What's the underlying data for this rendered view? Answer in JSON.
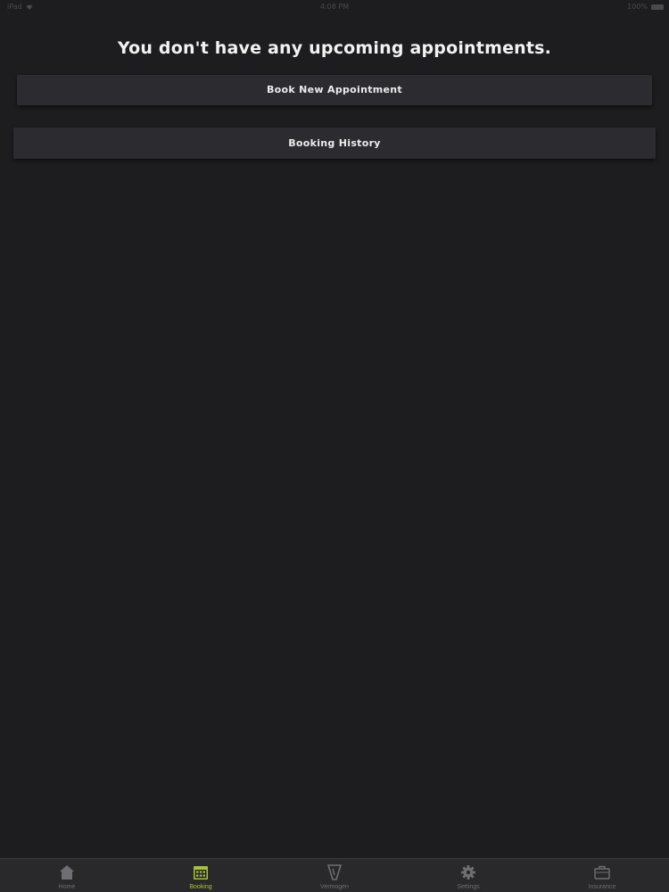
{
  "status_bar": {
    "carrier": "iPad",
    "time": "4:08 PM",
    "battery": "100%"
  },
  "main": {
    "empty_message": "You don't have any upcoming appointments.",
    "book_button_label": "Book New Appointment",
    "history_button_label": "Booking History"
  },
  "tab_bar": {
    "items": [
      {
        "label": "Home",
        "icon": "home-icon",
        "active": false
      },
      {
        "label": "Booking",
        "icon": "calendar-icon",
        "active": true
      },
      {
        "label": "Vermogen",
        "icon": "v-logo-icon",
        "active": false
      },
      {
        "label": "Settings",
        "icon": "gear-icon",
        "active": false
      },
      {
        "label": "Insurance",
        "icon": "briefcase-icon",
        "active": false
      }
    ]
  },
  "colors": {
    "background": "#1d1c1f",
    "button": "#2c2b2f",
    "tab_bar": "#29282b",
    "accent_active": "#a6c23a",
    "tab_inactive": "#6f6e72"
  }
}
